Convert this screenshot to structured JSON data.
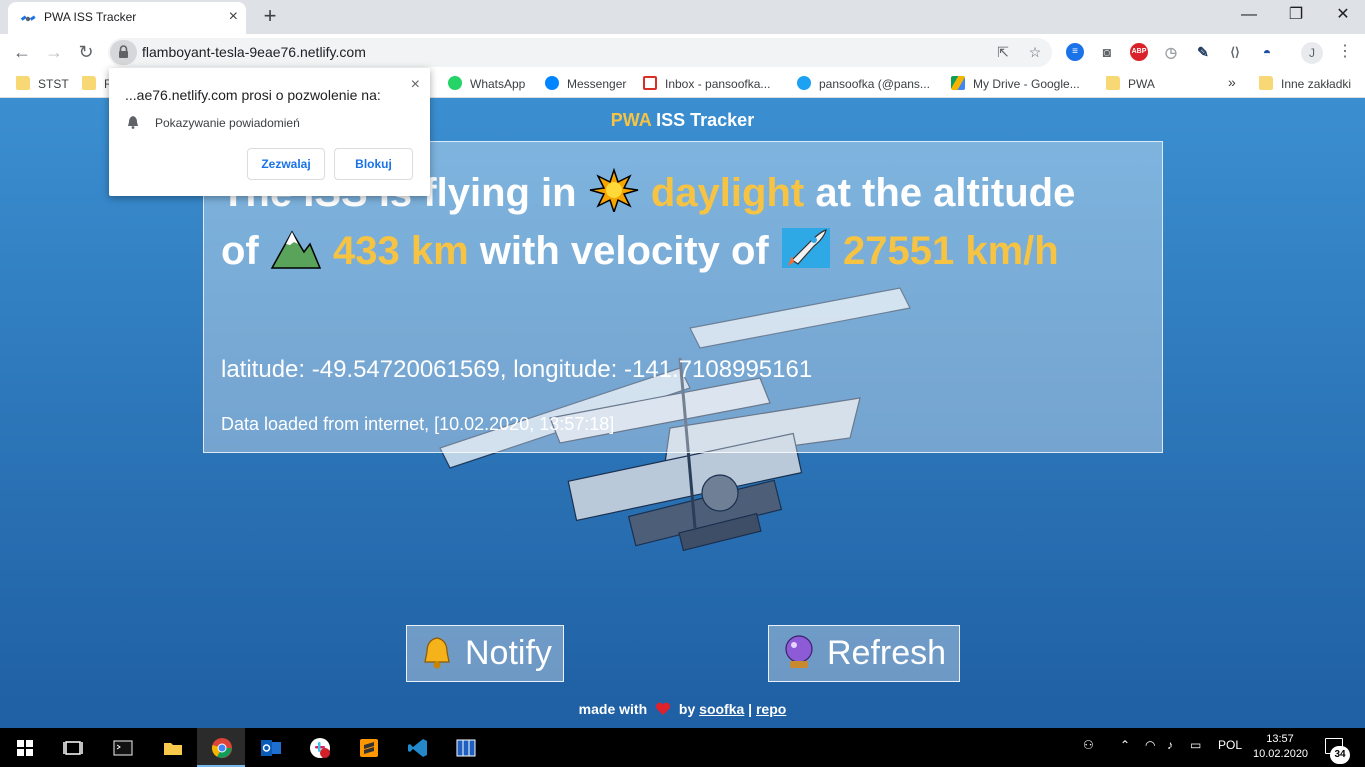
{
  "browser": {
    "tab": {
      "title": "PWA ISS Tracker",
      "close_icon": "×"
    },
    "new_tab_icon": "+",
    "window_controls": {
      "minimize": "—",
      "maximize": "❐",
      "close": "✕"
    },
    "url": "flamboyant-tesla-9eae76.netlify.com",
    "profile_initial": "J",
    "extensions": [
      {
        "name": "ext-blue-icon",
        "color": "#1a73e8"
      },
      {
        "name": "camera-icon",
        "color": "#5f6368"
      },
      {
        "name": "adblock-icon",
        "label": "ABP",
        "color": "#d9222a"
      }
    ]
  },
  "bookmarks": [
    {
      "label": "STST",
      "icon": "folder"
    },
    {
      "label": "R",
      "icon": "folder"
    },
    {
      "label": "WhatsApp",
      "icon": "whatsapp"
    },
    {
      "label": "Messenger",
      "icon": "messenger"
    },
    {
      "label": "Inbox - pansoofka...",
      "icon": "gmail"
    },
    {
      "label": "pansoofka (@pans...",
      "icon": "twitter"
    },
    {
      "label": "My Drive - Google...",
      "icon": "drive"
    },
    {
      "label": "PWA",
      "icon": "folder"
    },
    {
      "label": "»",
      "icon": "none"
    },
    {
      "label": "Inne zakładki",
      "icon": "folder"
    }
  ],
  "permission_popup": {
    "title": "...ae76.netlify.com prosi o pozwolenie na:",
    "permission": "Pokazywanie powiadomień",
    "allow_label": "Zezwalaj",
    "block_label": "Blokuj",
    "close_icon": "×"
  },
  "app": {
    "header_pwa": "PWA",
    "header_rest": " ISS Tracker",
    "headline": {
      "part1": "The ISS is flying in",
      "condition": "daylight",
      "part2": "at the altitude of",
      "altitude": "433 km",
      "part3": "with velocity of",
      "velocity": "27551 km/h"
    },
    "coords": "latitude: -49.54720061569, longitude: -141.7108995161",
    "loaded": "Data loaded from internet, [10.02.2020, 13:57:18]",
    "notify_label": "Notify",
    "refresh_label": "Refresh",
    "footer": {
      "made_with": "made with",
      "by": "by",
      "author": "soofka",
      "separator": "|",
      "repo": "repo"
    }
  },
  "taskbar": {
    "language": "POL",
    "time": "13:57",
    "date": "10.02.2020",
    "notifications_count": "34"
  }
}
